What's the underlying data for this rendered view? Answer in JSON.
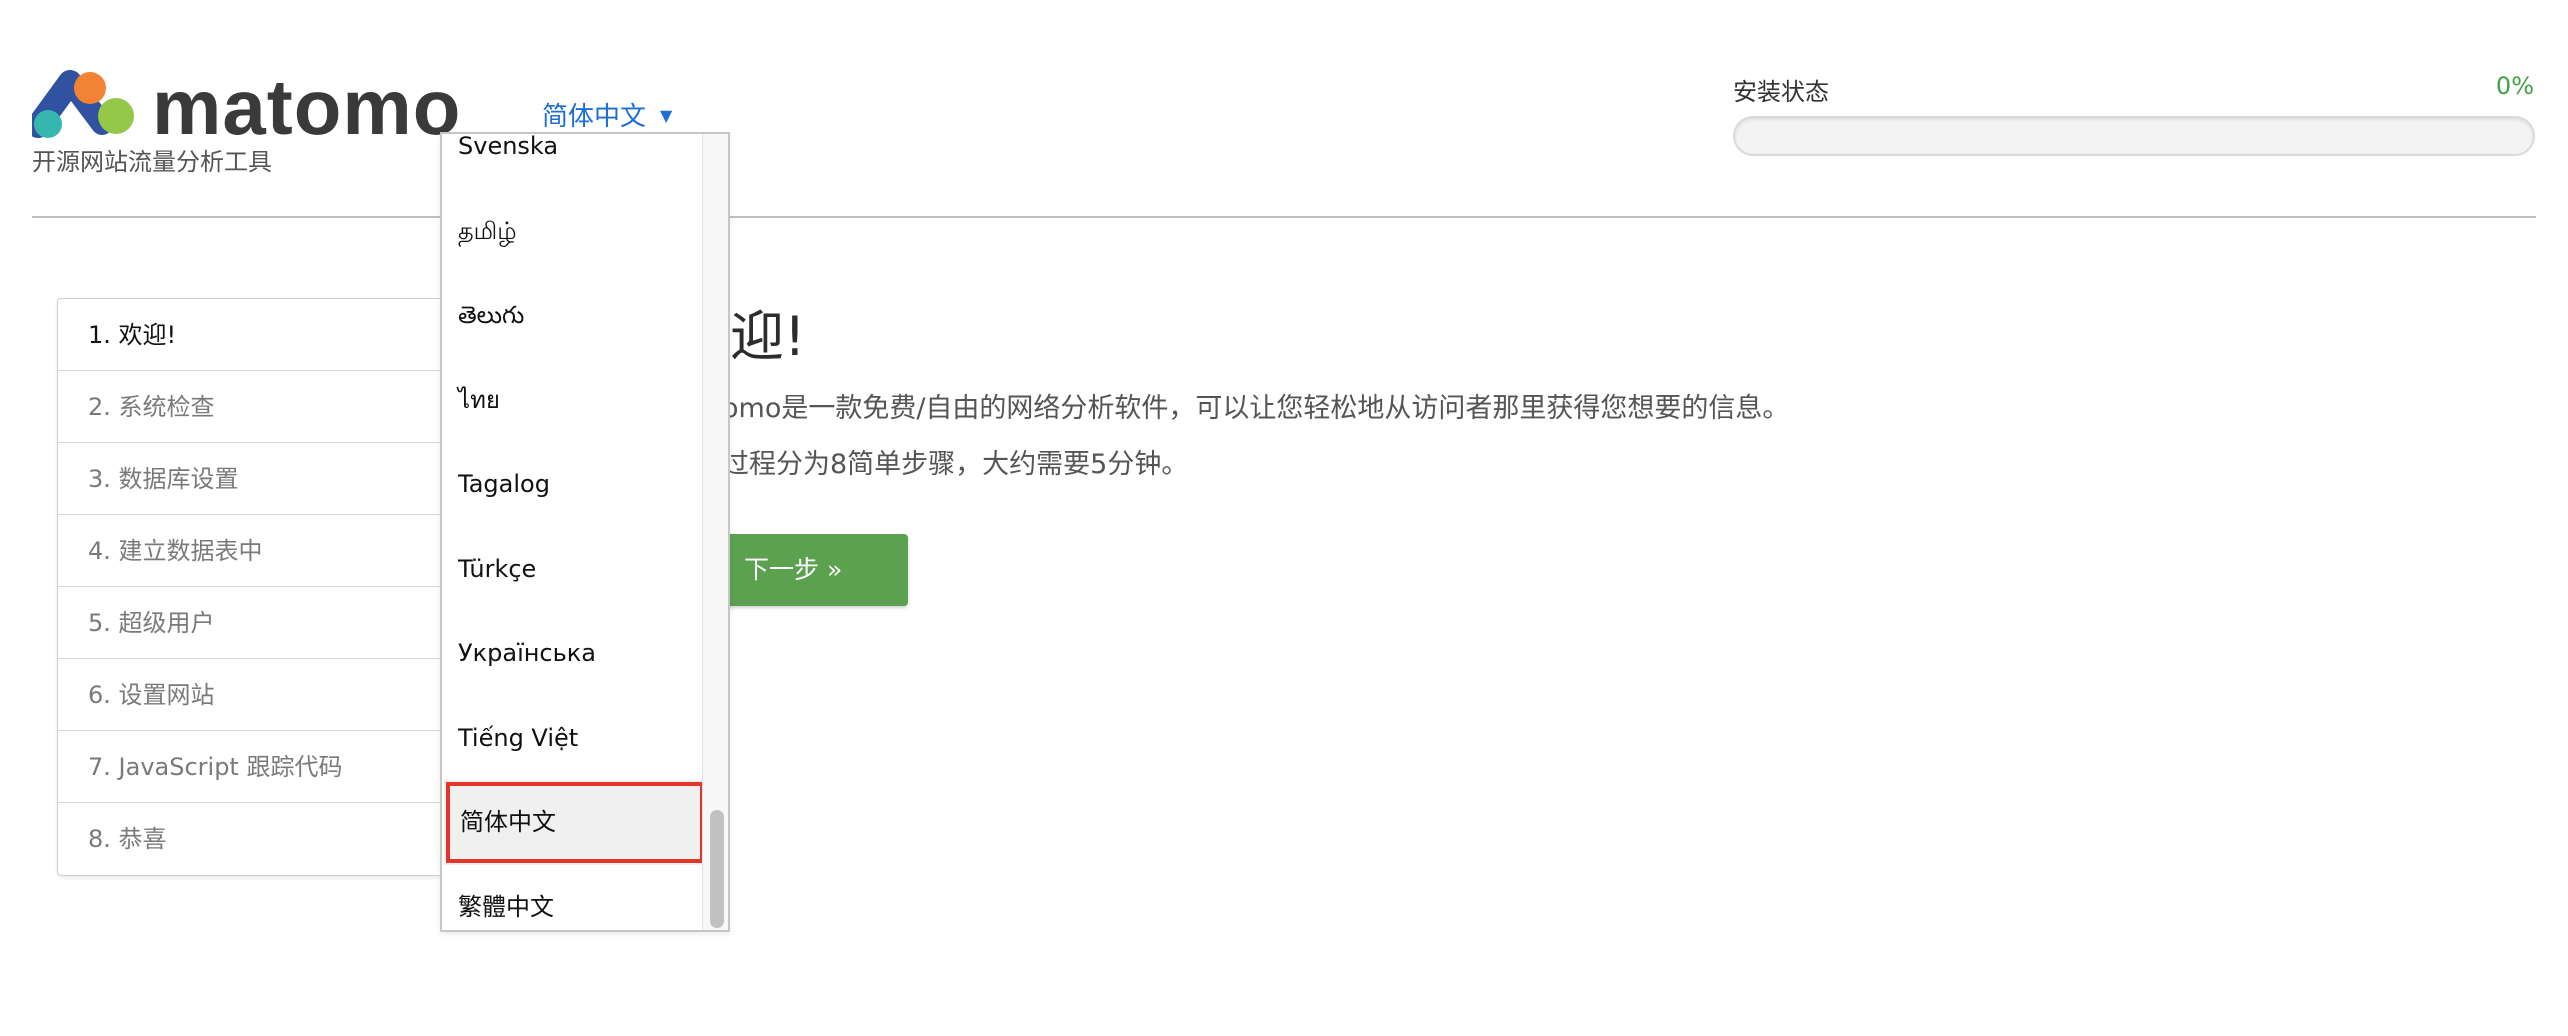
{
  "header": {
    "logo_text": "matomo",
    "tagline": "开源网站流量分析工具",
    "language_selected": "简体中文",
    "install_label": "安装状态",
    "install_percent": "0%",
    "install_progress": 0
  },
  "steps": [
    {
      "label": "1. 欢迎!"
    },
    {
      "label": "2. 系统检查"
    },
    {
      "label": "3. 数据库设置"
    },
    {
      "label": "4. 建立数据表中"
    },
    {
      "label": "5. 超级用户"
    },
    {
      "label": "6. 设置网站"
    },
    {
      "label": "7. JavaScript 跟踪代码"
    },
    {
      "label": "8. 恭喜"
    }
  ],
  "main": {
    "title": "迎!",
    "paragraph1": "omo是一款免费/自由的网络分析软件，可以让您轻松地从访问者那里获得您想要的信息。",
    "paragraph2": "过程分为8简单步骤，大约需要5分钟。",
    "next_button": "下一步 »"
  },
  "language_dropdown": {
    "items": [
      "Svenska",
      "தமிழ்",
      "తెలుగు",
      "ไทย",
      "Tagalog",
      "Türkçe",
      "Українська",
      "Tiếng Việt",
      "简体中文",
      "繁體中文"
    ],
    "selected": "简体中文"
  },
  "colors": {
    "accent_green": "#5ba150",
    "link_blue": "#1f6fd1",
    "highlight_red": "#e3362a"
  }
}
